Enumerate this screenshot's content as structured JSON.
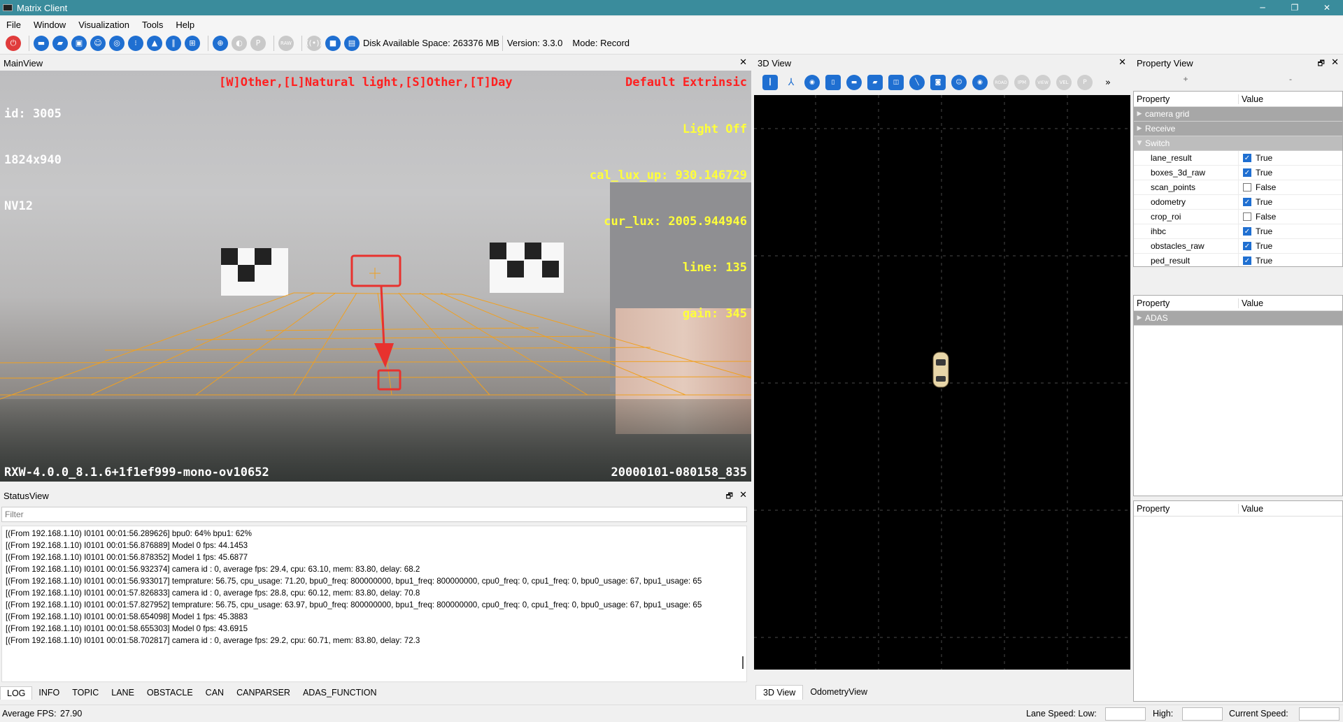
{
  "window": {
    "title": "Matrix Client",
    "minimize": "─",
    "maximize": "❐",
    "close": "✕"
  },
  "menu": [
    "File",
    "Window",
    "Visualization",
    "Tools",
    "Help"
  ],
  "toolbar": {
    "disk_space": "Disk Available Space: 263376 MB",
    "version": "Version: 3.3.0",
    "mode": "Mode: Record",
    "raw_label": "RAW"
  },
  "main_view": {
    "title": "MainView",
    "close": "✕",
    "overlay_left": [
      "id: 3005",
      "1824x940",
      "NV12"
    ],
    "overlay_center": "[W]Other,[L]Natural light,[S]Other,[T]Day",
    "overlay_right": [
      "Default Extrinsic",
      "Light Off",
      "cal_lux_up: 930.146729",
      "cur_lux: 2005.944946",
      "line: 135",
      "gain: 345"
    ],
    "footer_left": "RXW-4.0.0_8.1.6+1f1ef999-mono-ov10652",
    "footer_right": "20000101-080158_835"
  },
  "status_view": {
    "title": "StatusView",
    "filter_placeholder": "Filter",
    "float": "🗗",
    "close": "✕",
    "log": [
      "[(From 192.168.1.10) I0101 00:01:56.289626] bpu0: 64% bpu1: 62%",
      "[(From 192.168.1.10) I0101 00:01:56.876889] Model 0 fps: 44.1453",
      "[(From 192.168.1.10) I0101 00:01:56.878352] Model 1 fps: 45.6877",
      "[(From 192.168.1.10) I0101 00:01:56.932374] camera id : 0, average fps: 29.4, cpu: 63.10, mem: 83.80, delay: 68.2",
      "[(From 192.168.1.10) I0101 00:01:56.933017] temprature: 56.75, cpu_usage: 71.20, bpu0_freq: 800000000, bpu1_freq: 800000000, cpu0_freq: 0, cpu1_freq: 0, bpu0_usage: 67, bpu1_usage: 65",
      "[(From 192.168.1.10) I0101 00:01:57.826833] camera id : 0, average fps: 28.8, cpu: 60.12, mem: 83.80, delay: 70.8",
      "[(From 192.168.1.10) I0101 00:01:57.827952] temprature: 56.75, cpu_usage: 63.97, bpu0_freq: 800000000, bpu1_freq: 800000000, cpu0_freq: 0, cpu1_freq: 0, bpu0_usage: 67, bpu1_usage: 65",
      "[(From 192.168.1.10) I0101 00:01:58.654098] Model 1 fps: 45.3883",
      "[(From 192.168.1.10) I0101 00:01:58.655303] Model 0 fps: 43.6915",
      "[(From 192.168.1.10) I0101 00:01:58.702817] camera id : 0, average fps: 29.2, cpu: 60.71, mem: 83.80, delay: 72.3"
    ],
    "tabs": [
      "LOG",
      "INFO",
      "TOPIC",
      "LANE",
      "OBSTACLE",
      "CAN",
      "CANPARSER",
      "ADAS_FUNCTION"
    ]
  },
  "view3d": {
    "title": "3D View",
    "close": "✕",
    "more": "»",
    "icon_labels": {
      "road": "ROAD",
      "ipm": "IPM",
      "view": "VIEW",
      "vel": "VEL"
    },
    "tabs": [
      "3D View",
      "OdometryView"
    ]
  },
  "property_view": {
    "title": "Property View",
    "float": "🗗",
    "close": "✕",
    "add": "+",
    "remove": "-",
    "header": {
      "property": "Property",
      "value": "Value"
    },
    "table1": {
      "groups": [
        {
          "name": "camera grid",
          "expanded": false
        },
        {
          "name": "Receive",
          "expanded": false
        },
        {
          "name": "Switch",
          "expanded": true
        }
      ],
      "rows": [
        {
          "name": "lane_result",
          "value": "True",
          "checked": true
        },
        {
          "name": "boxes_3d_raw",
          "value": "True",
          "checked": true
        },
        {
          "name": "scan_points",
          "value": "False",
          "checked": false
        },
        {
          "name": "odometry",
          "value": "True",
          "checked": true
        },
        {
          "name": "crop_roi",
          "value": "False",
          "checked": false
        },
        {
          "name": "ihbc",
          "value": "True",
          "checked": true
        },
        {
          "name": "obstacles_raw",
          "value": "True",
          "checked": true
        },
        {
          "name": "ped_result",
          "value": "True",
          "checked": true
        }
      ]
    },
    "table2": {
      "groups": [
        {
          "name": "ADAS",
          "expanded": false
        }
      ]
    }
  },
  "status_bar": {
    "fps_label": "Average FPS:",
    "fps_value": "27.90",
    "lane_speed_low": "Lane Speed: Low:",
    "high": "High:",
    "current_speed": "Current Speed:"
  }
}
